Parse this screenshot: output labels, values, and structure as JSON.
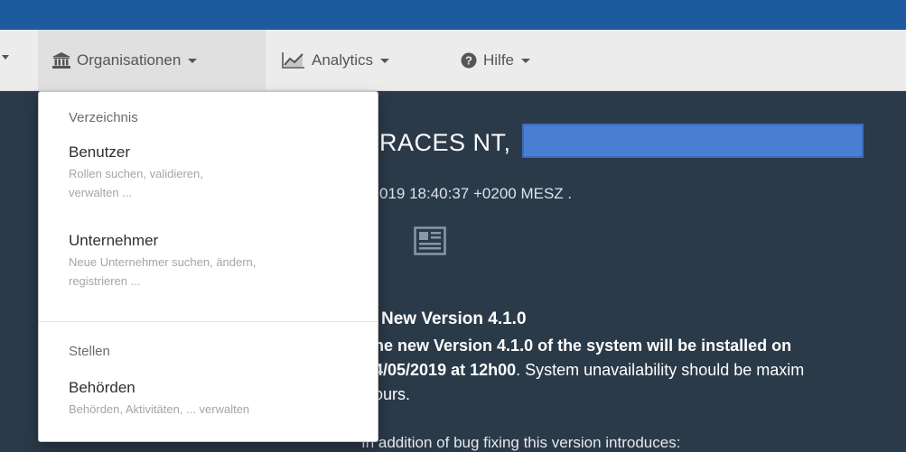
{
  "navbar": {
    "items": [
      {
        "label": "Organisationen",
        "icon": "institution-icon"
      },
      {
        "label": "Analytics",
        "icon": "area-chart-icon"
      },
      {
        "label": "Hilfe",
        "icon": "question-circle-icon"
      }
    ]
  },
  "dropdown": {
    "sections": [
      {
        "header": "Verzeichnis",
        "items": [
          {
            "title": "Benutzer",
            "desc": [
              "Rollen suchen, validieren,",
              "verwalten ..."
            ]
          },
          {
            "title": "Unternehmer",
            "desc": [
              "Neue Unternehmer suchen, ändern,",
              "registrieren ..."
            ]
          }
        ]
      },
      {
        "header": "Stellen",
        "items": [
          {
            "title": "Behörden",
            "desc": [
              "Behörden, Aktivitäten, ... verwalten"
            ]
          }
        ]
      }
    ]
  },
  "main": {
    "record_name": "RACES NT,",
    "record_date": "019 18:40:37 +0200 MESZ .",
    "news_title": "New Version 4.1.0",
    "news_lines": [
      {
        "bold": "he new Version 4.1.0 of the system will be installed on",
        "normal": ""
      },
      {
        "bold": "4/05/2019 at 12h00",
        "normal": ". System unavailability should be maxim"
      },
      {
        "bold": "",
        "normal": "ours."
      }
    ],
    "news_foot": "In addition of bug fixing this version introduces:"
  },
  "colors": {
    "topbar": "#1d5a9e",
    "navbar": "#ececec",
    "page_background": "#2b3a49",
    "redaction": "#4a7ed2"
  }
}
